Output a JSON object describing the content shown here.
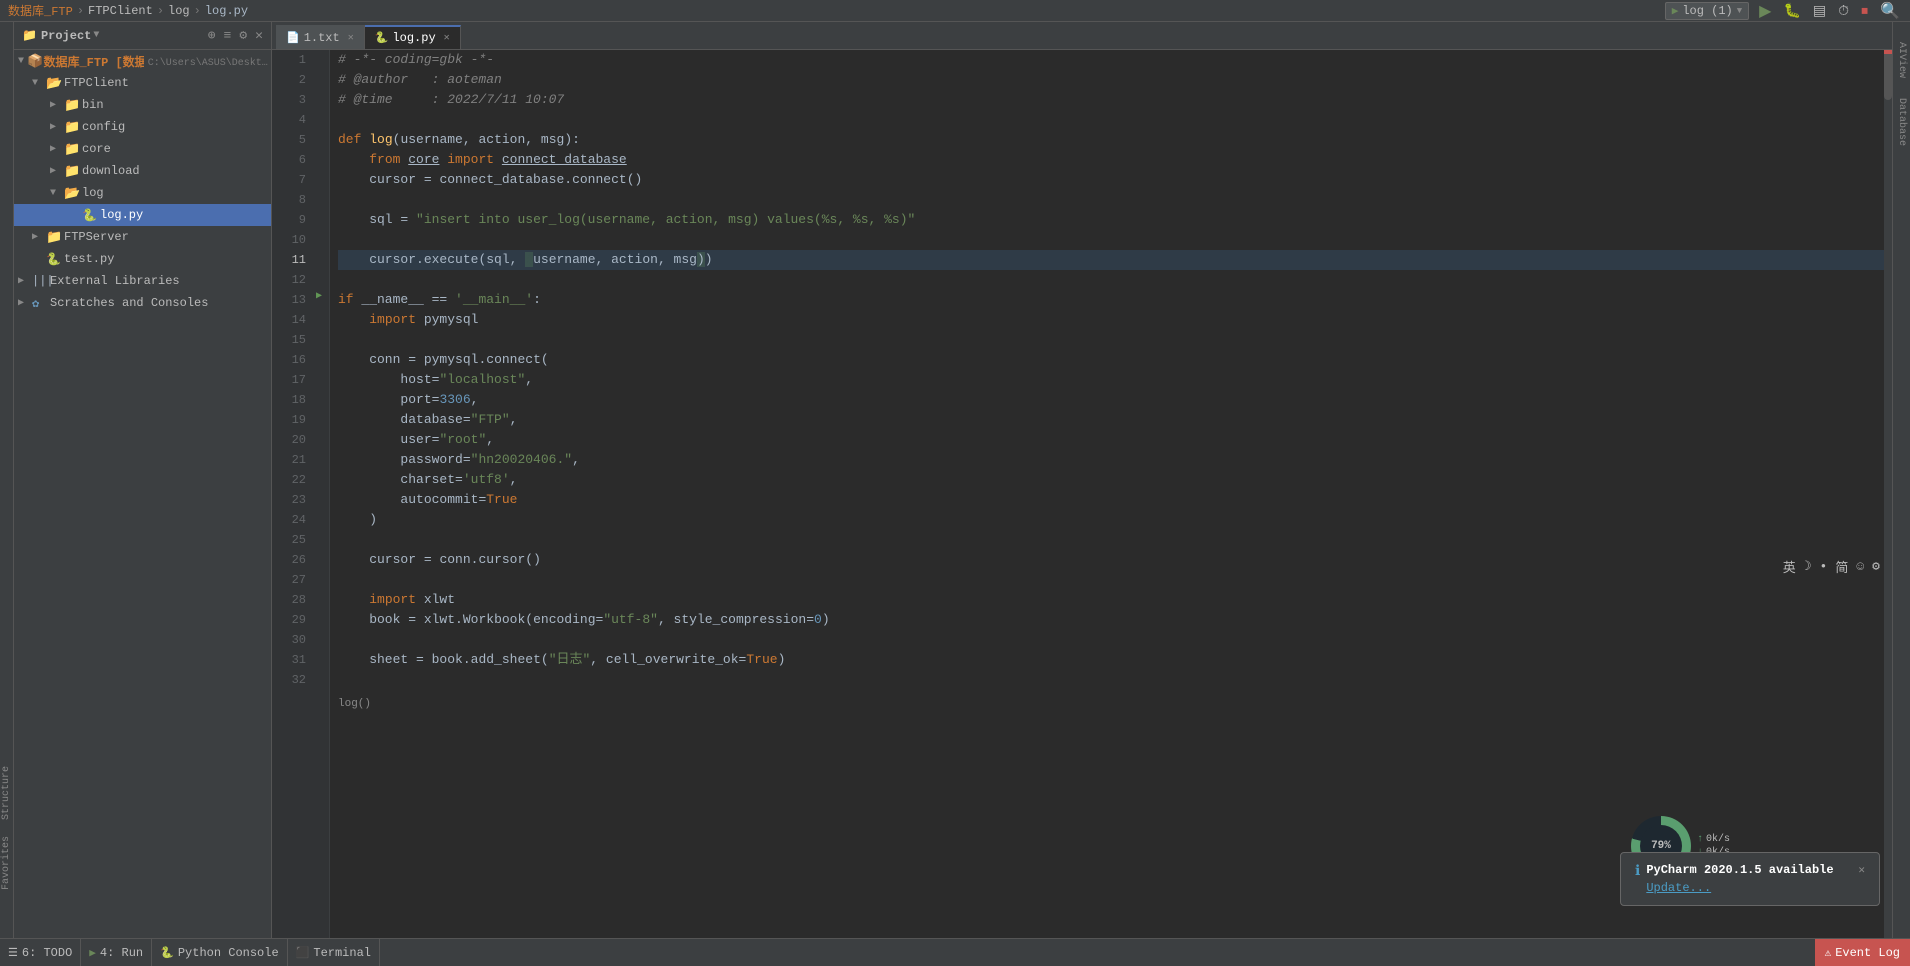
{
  "titlebar": {
    "breadcrumb": [
      "数据库_FTP",
      "FTPClient",
      "log",
      "log.py"
    ]
  },
  "toolbar": {
    "run_config": "log (1)",
    "run_btn": "▶",
    "debug_btn": "🐛",
    "coverage_btn": "▤",
    "profile_btn": "⏱",
    "stop_btn": "⏹",
    "search_btn": "🔍"
  },
  "project_panel": {
    "title": "Project",
    "root": {
      "name": "数据库_FTP [数据库+FTP]",
      "path": "C:\\Users\\ASUS\\Desktop\\数据库_FTP",
      "children": [
        {
          "name": "FTPClient",
          "type": "folder",
          "expanded": true,
          "children": [
            {
              "name": "bin",
              "type": "folder",
              "expanded": false
            },
            {
              "name": "config",
              "type": "folder",
              "expanded": false
            },
            {
              "name": "core",
              "type": "folder",
              "expanded": false
            },
            {
              "name": "download",
              "type": "folder",
              "expanded": false
            },
            {
              "name": "log",
              "type": "folder",
              "expanded": true,
              "children": [
                {
                  "name": "log.py",
                  "type": "py",
                  "selected": true
                }
              ]
            }
          ]
        },
        {
          "name": "FTPServer",
          "type": "folder",
          "expanded": false
        },
        {
          "name": "test.py",
          "type": "py"
        }
      ]
    },
    "external_libs": "External Libraries",
    "scratches": "Scratches and Consoles"
  },
  "tabs": [
    {
      "name": "1.txt",
      "active": false,
      "closable": true
    },
    {
      "name": "log.py",
      "active": true,
      "closable": true
    }
  ],
  "code_lines": [
    {
      "num": 1,
      "content": "# -*- coding=gbk -*-",
      "type": "comment"
    },
    {
      "num": 2,
      "content": "# @author   : aoteman",
      "type": "comment"
    },
    {
      "num": 3,
      "content": "# @time     : 2022/7/11 10:07",
      "type": "comment"
    },
    {
      "num": 4,
      "content": "",
      "type": "blank"
    },
    {
      "num": 5,
      "content": "def log(username, action, msg):",
      "type": "code"
    },
    {
      "num": 6,
      "content": "    from core import connect_database",
      "type": "code"
    },
    {
      "num": 7,
      "content": "    cursor = connect_database.connect()",
      "type": "code"
    },
    {
      "num": 8,
      "content": "",
      "type": "blank"
    },
    {
      "num": 9,
      "content": "    sql = \"insert into user_log(username, action, msg) values(%s, %s, %s)\"",
      "type": "code"
    },
    {
      "num": 10,
      "content": "",
      "type": "blank"
    },
    {
      "num": 11,
      "content": "    cursor.execute(sql, (username, action, msg))",
      "type": "code",
      "active": true
    },
    {
      "num": 12,
      "content": "",
      "type": "blank"
    },
    {
      "num": 13,
      "content": "if __name__ == '__main__':",
      "type": "code",
      "has_fold": true
    },
    {
      "num": 14,
      "content": "    import pymysql",
      "type": "code"
    },
    {
      "num": 15,
      "content": "",
      "type": "blank"
    },
    {
      "num": 16,
      "content": "    conn = pymysql.connect(",
      "type": "code"
    },
    {
      "num": 17,
      "content": "        host=\"localhost\",",
      "type": "code"
    },
    {
      "num": 18,
      "content": "        port=3306,",
      "type": "code"
    },
    {
      "num": 19,
      "content": "        database=\"FTP\",",
      "type": "code"
    },
    {
      "num": 20,
      "content": "        user=\"root\",",
      "type": "code"
    },
    {
      "num": 21,
      "content": "        password=\"hn20020406.\",",
      "type": "code"
    },
    {
      "num": 22,
      "content": "        charset='utf8',",
      "type": "code"
    },
    {
      "num": 23,
      "content": "        autocommit=True",
      "type": "code"
    },
    {
      "num": 24,
      "content": "    )",
      "type": "code"
    },
    {
      "num": 25,
      "content": "",
      "type": "blank"
    },
    {
      "num": 26,
      "content": "    cursor = conn.cursor()",
      "type": "code"
    },
    {
      "num": 27,
      "content": "",
      "type": "blank"
    },
    {
      "num": 28,
      "content": "    import xlwt",
      "type": "code"
    },
    {
      "num": 29,
      "content": "    book = xlwt.Workbook(encoding=\"utf-8\", style_compression=0)",
      "type": "code"
    },
    {
      "num": 30,
      "content": "",
      "type": "blank"
    },
    {
      "num": 31,
      "content": "    sheet = book.add_sheet(\"日志\", cell_overwrite_ok=True)",
      "type": "code"
    },
    {
      "num": 32,
      "content": "",
      "type": "blank"
    }
  ],
  "status_bar": {
    "todo_label": "6: TODO",
    "run_label": "4: Run",
    "python_console_label": "Python Console",
    "terminal_label": "Terminal",
    "event_log_label": "Event Log"
  },
  "notification": {
    "title": "PyCharm 2020.1.5 available",
    "link_text": "Update...",
    "icon": "ℹ"
  },
  "side_tabs": {
    "left": [
      "Structure",
      "Favorites"
    ],
    "right": [
      "AIView",
      "Database"
    ]
  },
  "system_tray": {
    "lang": "英",
    "moon": "☽",
    "dot": "•",
    "chinese": "简",
    "emoji": "☺",
    "settings": "⚙"
  },
  "cpu_widget": {
    "percent": "79%"
  }
}
